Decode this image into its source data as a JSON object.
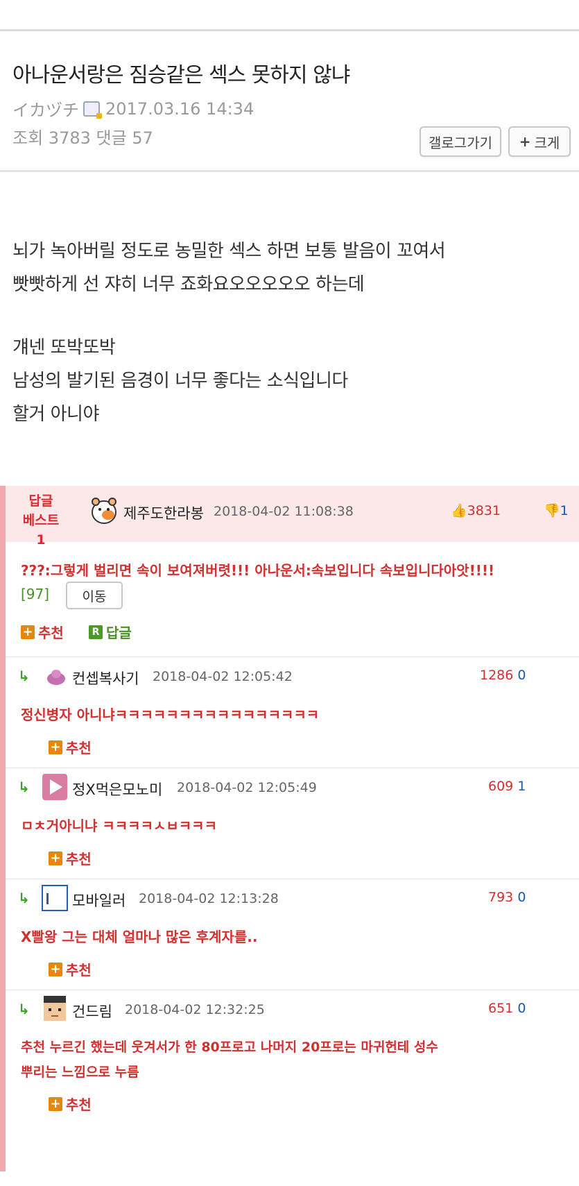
{
  "post": {
    "title": "아나운서랑은 짐승같은 섹스 못하지 않냐",
    "author": "イカヅチ",
    "author_icon": "gallery-member-icon",
    "datetime": "2017.03.16 14:34",
    "views_label": "조회",
    "views": "3783",
    "comments_label": "댓글",
    "comments": "57",
    "gallery_button": "갤로그가기",
    "zoom_button": "크게",
    "body": [
      "뇌가 녹아버릴 정도로 농밀한 섹스 하면 보통 발음이 꼬여서",
      "빳빳하게 선 쟈히 너무 죠화요오오오오오 하는데",
      "",
      "걔넨 또박또박",
      "남성의 발기된 음경이 너무 좋다는 소식입니다",
      "할거 아니야"
    ]
  },
  "best_reply": {
    "label_line1": "답글",
    "label_line2": "베스트1",
    "nick": "제주도한라봉",
    "datetime": "2018-04-02 11:08:38",
    "up": "3831",
    "down": "1",
    "text": "???:그렇게 벌리면 속이 보여져버렷!!! 아나운서:속보입니다 속보입니다아앗!!!!",
    "ref": "[97]",
    "move_button": "이동",
    "recommend": "추천",
    "reply": "답글"
  },
  "replies": [
    {
      "nick": "컨셉복사기",
      "datetime": "2018-04-02 12:05:42",
      "up": "1286",
      "down": "0",
      "text": "정신병자 아니냐ㅋㅋㅋㅋㅋㅋㅋㅋㅋㅋㅋㅋㅋㅋㅋㅋ",
      "recommend": "추천"
    },
    {
      "nick": "정X먹은모노미",
      "datetime": "2018-04-02 12:05:49",
      "up": "609",
      "down": "1",
      "text": "ㅁㅊ거아니냐 ㅋㅋㅋㅋㅅㅂㅋㅋㅋ",
      "recommend": "추천"
    },
    {
      "nick": "모바일러",
      "datetime": "2018-04-02 12:13:28",
      "up": "793",
      "down": "0",
      "text": "X빨왕 그는 대체 얼마나 많은 후계자를..",
      "recommend": "추천"
    },
    {
      "nick": "건드림",
      "datetime": "2018-04-02 12:32:25",
      "up": "651",
      "down": "0",
      "text_line1": "추천 누르긴 했는데 웃겨서가 한 80프로고 나머지 20프로는 마귀헌테 성수",
      "text_line2": "뿌리는 느낌으로 누름",
      "recommend": "추천"
    }
  ],
  "reply_arrow": "↳",
  "colors": {
    "accent_red": "#d32f2f",
    "best_bg": "#fce8e9",
    "left_bar": "#f2a6ad",
    "down_blue": "#1a56b6"
  }
}
